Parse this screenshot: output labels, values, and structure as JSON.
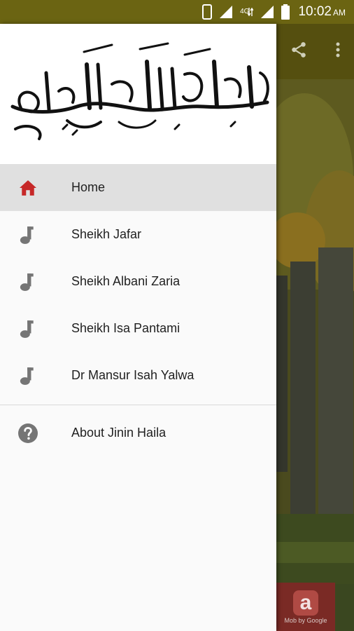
{
  "status_bar": {
    "network_label": "4G",
    "time": "10:02",
    "ampm": "AM",
    "bar_color": "#6b6412"
  },
  "drawer": {
    "header_logo": "Bismillah calligraphy",
    "menu": [
      {
        "label": "Home",
        "icon": "home-icon",
        "active": true
      },
      {
        "label": "Sheikh Jafar",
        "icon": "music-note-icon"
      },
      {
        "label": "Sheikh Albani Zaria",
        "icon": "music-note-icon"
      },
      {
        "label": "Sheikh Isa Pantami",
        "icon": "music-note-icon"
      },
      {
        "label": "Dr Mansur Isah Yalwa",
        "icon": "music-note-icon"
      }
    ],
    "secondary_menu": [
      {
        "label": "About Jinin Haila",
        "icon": "help-icon"
      }
    ],
    "accent_color": "#c62828"
  },
  "background_app": {
    "toolbar_icons": [
      "share-icon",
      "more-vert-icon"
    ],
    "ad_caption": "Mob by Google"
  }
}
